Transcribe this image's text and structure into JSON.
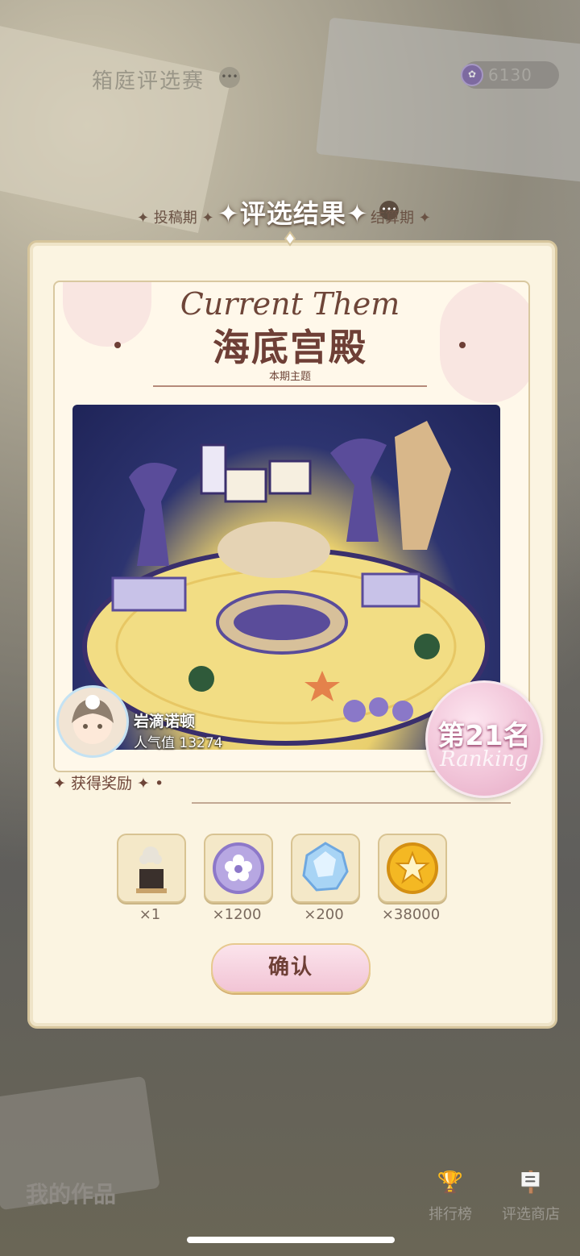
{
  "header": {
    "title": "箱庭评选赛",
    "currency_value": "6130"
  },
  "phases": {
    "left": "✦ 投稿期 ✦",
    "center": "评选结果",
    "right": "结算期 ✦"
  },
  "theme": {
    "script_title": "Current Them",
    "name": "海底宫殿",
    "subtitle": "本期主题"
  },
  "entry": {
    "author_name": "岩滴诺顿",
    "popularity": "人气值 13274",
    "rank": "第21名",
    "rank_script": "Ranking"
  },
  "rewards": {
    "title": "✦ 获得奖励 ✦ •",
    "items": [
      {
        "icon": "furniture-item-icon",
        "qty": "×1"
      },
      {
        "icon": "purple-flower-coin-icon",
        "qty": "×1200"
      },
      {
        "icon": "blue-crystal-icon",
        "qty": "×200"
      },
      {
        "icon": "gold-star-coin-icon",
        "qty": "×38000"
      }
    ]
  },
  "actions": {
    "confirm": "确认"
  },
  "bottom": {
    "my_works": "我的作品",
    "leaderboard": "排行榜",
    "shop": "评选商店"
  }
}
